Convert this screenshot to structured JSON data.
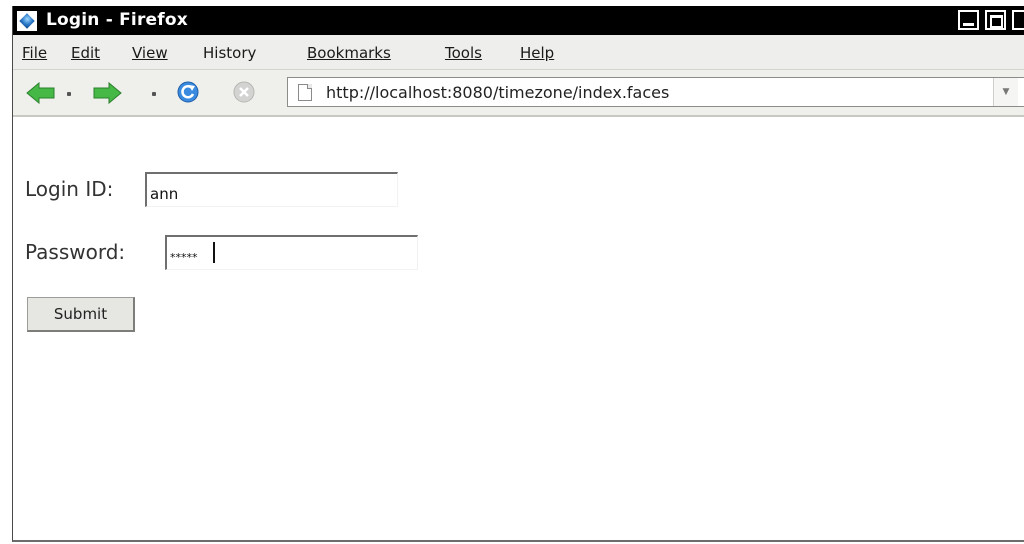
{
  "window": {
    "title": "Login - Firefox",
    "app_icon": "firefox-icon",
    "controls": [
      "minimize-icon",
      "maximize-icon",
      "close-icon"
    ]
  },
  "menubar": {
    "items": [
      {
        "label": "File",
        "mnemonic": "F"
      },
      {
        "label": "Edit",
        "mnemonic": "E"
      },
      {
        "label": "View",
        "mnemonic": "V"
      },
      {
        "label": "History",
        "mnemonic": "s"
      },
      {
        "label": "Bookmarks",
        "mnemonic": "B"
      },
      {
        "label": "Tools",
        "mnemonic": "T"
      },
      {
        "label": "Help",
        "mnemonic": "H"
      }
    ]
  },
  "navbar": {
    "icons": [
      "back-arrow-icon",
      "forward-arrow-icon",
      "reload-icon",
      "stop-icon",
      "page-icon",
      "go-icon"
    ],
    "url": "http://localhost:8080/timezone/index.faces"
  },
  "form": {
    "login_label": "Login ID:",
    "login_value": "ann",
    "password_label": "Password:",
    "password_value": "*****",
    "submit_label": "Submit"
  },
  "colors": {
    "titlebar": "#000000",
    "chrome": "#eeeeec",
    "forward_arrow": "#3fb03f",
    "back_arrow": "#3fb03f",
    "reload": "#2f7fd0"
  }
}
